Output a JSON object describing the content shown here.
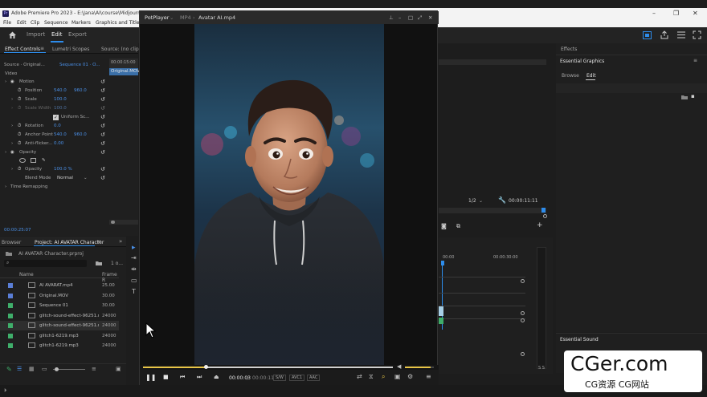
{
  "titlebar": {
    "title": "Adobe Premiere Pro 2023 - E:\\Jana\\AI\\course\\Midjourney",
    "minimize": "–",
    "maximize": "❐",
    "close": "✕"
  },
  "menu": {
    "items": [
      "File",
      "Edit",
      "Clip",
      "Sequence",
      "Markers",
      "Graphics and Titles"
    ]
  },
  "appbar": {
    "tabs": [
      "Import",
      "Edit",
      "Export"
    ],
    "active_tab": "Edit"
  },
  "effect_controls": {
    "tabs": [
      "Effect Controls",
      "Lumetri Scopes",
      "Source: (no clips)"
    ],
    "source_label": "Source · Original...",
    "sequence_label": "Sequence 01 · O...",
    "timecode_top": "00:00:15:00",
    "clip_name": "Original.MOV",
    "section_video": "Video",
    "motion": "Motion",
    "position": {
      "label": "Position",
      "x": "540.0",
      "y": "960.0"
    },
    "scale": {
      "label": "Scale",
      "value": "100.0"
    },
    "scale_width": {
      "label": "Scale Width",
      "value": "100.0"
    },
    "uniform_scale": "Uniform Sc...",
    "rotation": {
      "label": "Rotation",
      "value": "0.0"
    },
    "anchor": {
      "label": "Anchor Point",
      "x": "540.0",
      "y": "960.0"
    },
    "anti_flicker": {
      "label": "Anti-flicker...",
      "value": "0.00"
    },
    "opacity": "Opacity",
    "opacity_value": {
      "label": "Opacity",
      "value": "100.0 %"
    },
    "blend_mode": {
      "label": "Blend Mode",
      "value": "Normal"
    },
    "time_remapping": "Time Remapping",
    "bottom_timecode": "00:00:25:07"
  },
  "project": {
    "tabs": [
      "Browser",
      "Project: AI AVATAR Character"
    ],
    "project_file": "AI AVATAR Character.prproj",
    "count": "1 o...",
    "columns": [
      "Name",
      "Frame R"
    ],
    "items": [
      {
        "name": "AI AVARAT.mp4",
        "rate": "25.00",
        "color": "#5a7ed6"
      },
      {
        "name": "Original.MOV",
        "rate": "30.00",
        "color": "#5a7ed6"
      },
      {
        "name": "Sequence 01",
        "rate": "30.00",
        "color": "#3fae6a"
      },
      {
        "name": "glitch-sound-effect-96251.m",
        "rate": "24000",
        "color": "#3fae6a"
      },
      {
        "name": "glitch-sound-effect-96251.m",
        "rate": "24000",
        "color": "#3fae6a"
      },
      {
        "name": "glitch1-6219.mp3",
        "rate": "24000",
        "color": "#3fae6a"
      },
      {
        "name": "glitch1-6219.mp3",
        "rate": "24000",
        "color": "#3fae6a"
      }
    ]
  },
  "potplayer": {
    "app": "PotPlayer",
    "format": "MP4",
    "file": "Avatar AI.mp4",
    "time_current": "00:00:03",
    "time_total": "00:00:11",
    "badges": [
      "S/W",
      "AVC1",
      "AAC"
    ],
    "progress": 0.25,
    "volume": 0.9
  },
  "program_monitor": {
    "fraction": "1/2",
    "timecode": "00:00:11:11"
  },
  "timeline": {
    "ticks": [
      "00:00",
      "00:00:30:00"
    ]
  },
  "essential_graphics": {
    "header": "Effects",
    "title": "Essential Graphics",
    "tabs": [
      "Browse",
      "Edit"
    ],
    "active_tab": "Edit"
  },
  "essential_sound": {
    "title": "Essential Sound"
  },
  "watermark": {
    "big": "CGer.com",
    "small": "CG资源 CG网站"
  },
  "colors": {
    "accent": "#2d8ceb",
    "value_blue": "#4a8fe6",
    "progress_yellow": "#e8c547"
  }
}
